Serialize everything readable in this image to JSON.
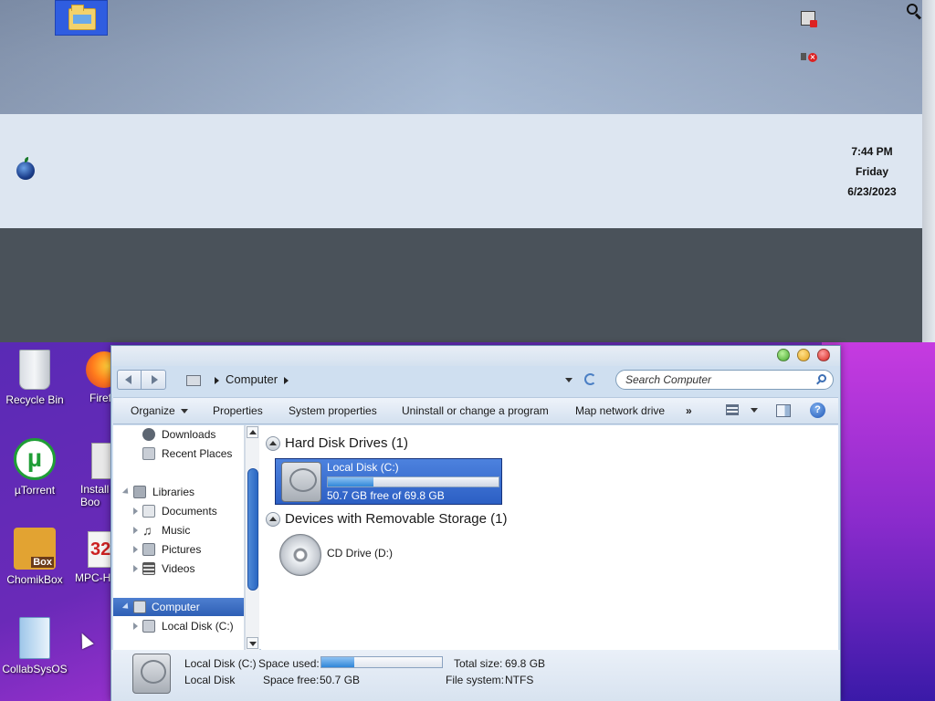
{
  "menubar": {
    "clock_time": "7:44 PM",
    "clock_day": "Friday",
    "clock_date": "6/23/2023"
  },
  "desktop": {
    "icons": [
      {
        "label": "Recycle Bin"
      },
      {
        "label": "Firef"
      },
      {
        "label": "µTorrent"
      },
      {
        "label": "Install",
        "label2": "Boo"
      },
      {
        "label": "ChomikBox"
      },
      {
        "label": "MPC-H"
      },
      {
        "label": "CollabSysOS"
      }
    ],
    "chomikbox_badge": "Box",
    "mpc_badge": "32",
    "utorrent_glyph": "µ"
  },
  "window": {
    "address": {
      "breadcrumb": "Computer",
      "search_placeholder": "Search Computer"
    },
    "toolbar": {
      "organize": "Organize",
      "properties": "Properties",
      "system_properties": "System properties",
      "uninstall": "Uninstall or change a program",
      "map_network_drive": "Map network drive",
      "more": "»",
      "help": "?"
    },
    "nav": {
      "items": [
        {
          "label": "Downloads"
        },
        {
          "label": "Recent Places"
        },
        {
          "label": "Libraries"
        },
        {
          "label": "Documents"
        },
        {
          "label": "Music"
        },
        {
          "label": "Pictures"
        },
        {
          "label": "Videos"
        },
        {
          "label": "Computer"
        },
        {
          "label": "Local Disk (C:)"
        }
      ]
    },
    "groups": {
      "hard_disk": "Hard Disk Drives (1)",
      "removable": "Devices with Removable Storage (1)"
    },
    "drives": {
      "local_disk": {
        "name": "Local Disk (C:)",
        "free_text": "50.7 GB free of 69.8 GB",
        "used_fraction": 0.27
      },
      "cd_drive": {
        "name": "CD Drive (D:)"
      }
    },
    "details": {
      "name": "Local Disk (C:)",
      "type": "Local Disk",
      "space_used_label": "Space used:",
      "space_free_label": "Space free:",
      "space_free_value": "50.7 GB",
      "total_size_label": "Total size:",
      "total_size_value": "69.8 GB",
      "file_system_label": "File system:",
      "file_system_value": "NTFS",
      "used_fraction": 0.27
    }
  }
}
